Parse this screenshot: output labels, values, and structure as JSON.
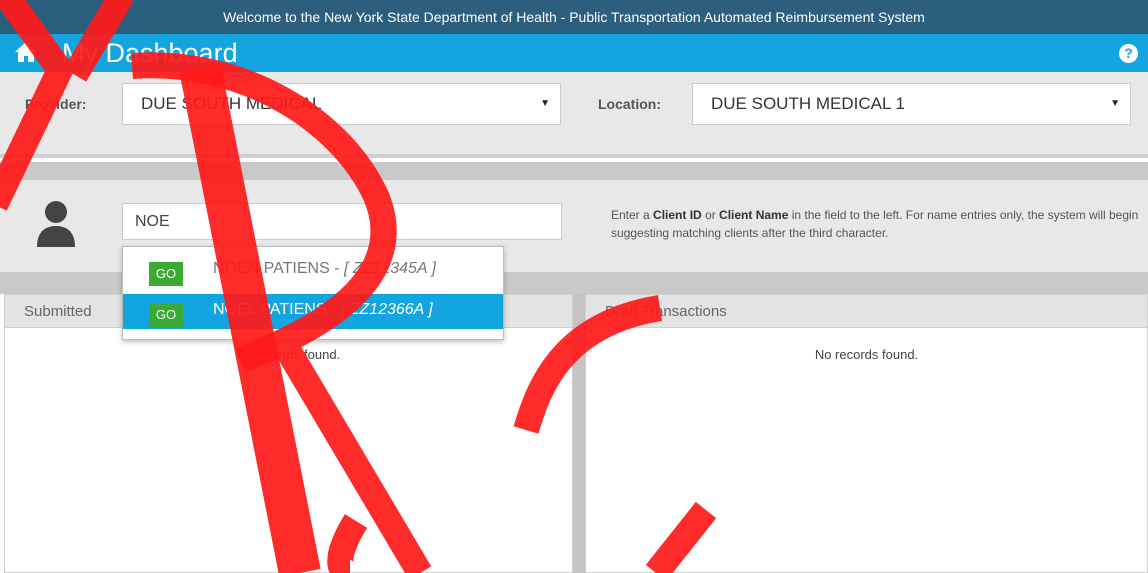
{
  "header": {
    "welcome_text": "Welcome to the New York State Department of Health - Public Transportation Automated Reimbursement System",
    "title": "My Dashboard",
    "help_label": "?"
  },
  "filters": {
    "provider_label": "Provider:",
    "provider_value": "DUE SOUTH MEDICAL",
    "location_label": "Location:",
    "location_value": "DUE SOUTH MEDICAL 1"
  },
  "client_search": {
    "value": "NOE",
    "help_prefix": "Enter a ",
    "help_client_id": "Client ID",
    "help_or": " or ",
    "help_client_name": "Client Name",
    "help_suffix": " in the field to the left. For name entries only, the system will begin suggesting matching clients after the third character.",
    "suggestions": [
      {
        "go": "GO",
        "name": "NOEN PATIENS - ",
        "id": "[ ZZ12345A ]"
      },
      {
        "go": "GO",
        "name": "NOEL PATIENS - ",
        "id": "[ ZZ12366A ]"
      }
    ]
  },
  "panels": {
    "submitted": {
      "title": "Submitted",
      "empty": "No records found."
    },
    "draft": {
      "title": "Draft Transactions",
      "empty": "No records found."
    }
  },
  "colors": {
    "welcome_bar": "#2c5f7e",
    "dashboard_bar": "#13a5e0",
    "go_button": "#3aaa35",
    "watermark": "#ff1a1a"
  }
}
